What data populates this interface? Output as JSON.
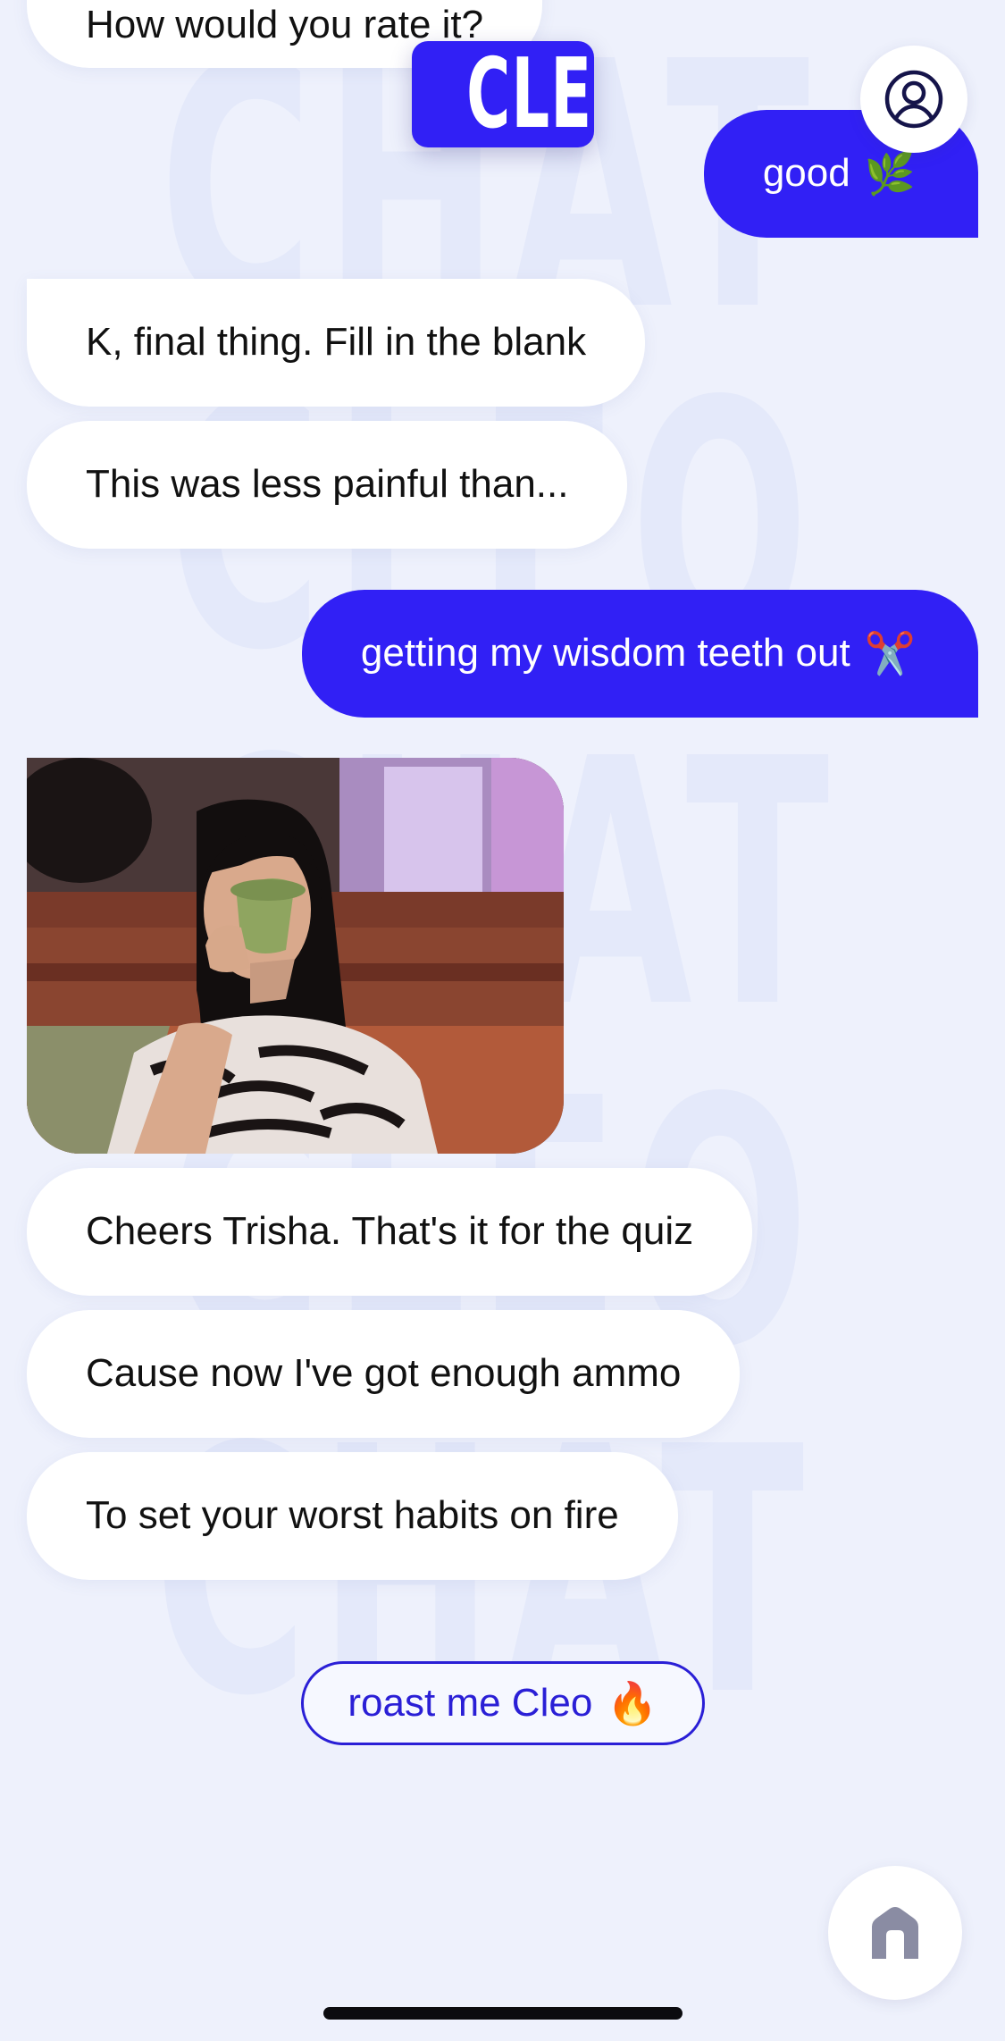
{
  "app": {
    "logo_text": "CLEO",
    "brand_color": "#3120F5",
    "background_color": "#EEF1FC"
  },
  "watermark": [
    "CHAT",
    "CLEO",
    "CHAT",
    "CLEO",
    "CHAT"
  ],
  "messages": [
    {
      "from": "bot",
      "text": "How would you rate it?"
    },
    {
      "from": "user",
      "text": "good",
      "emoji": "🌿"
    },
    {
      "from": "bot",
      "text": "K, final thing. Fill in the blank"
    },
    {
      "from": "bot",
      "text": "This was less painful than..."
    },
    {
      "from": "user",
      "text": "getting my wisdom teeth out",
      "emoji": "✂️"
    },
    {
      "from": "bot",
      "type": "gif"
    },
    {
      "from": "bot",
      "text": "Cheers Trisha. That's it for the quiz"
    },
    {
      "from": "bot",
      "text": "Cause now I've got enough ammo"
    },
    {
      "from": "bot",
      "text": "To set your worst habits on fire"
    }
  ],
  "quick_reply": {
    "label": "roast me Cleo",
    "emoji": "🔥"
  },
  "icons": {
    "profile": "profile-icon",
    "home": "home-icon"
  }
}
